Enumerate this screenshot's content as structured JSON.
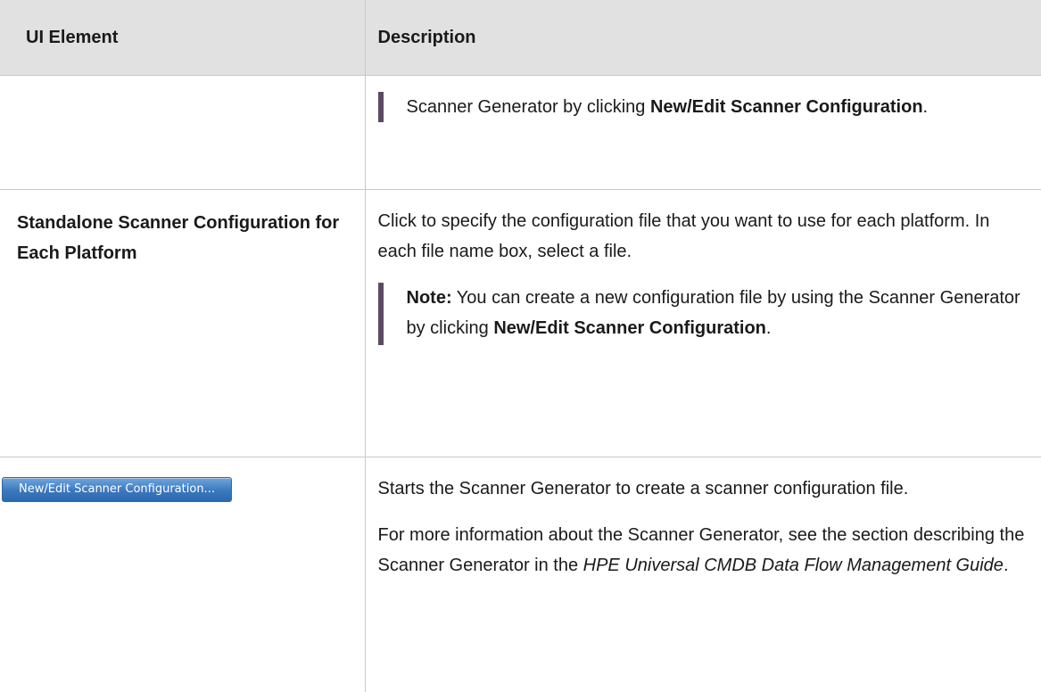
{
  "table": {
    "header": {
      "col1": "UI Element",
      "col2": "Description"
    },
    "row1": {
      "note_text": "Scanner Generator by clicking ",
      "note_bold": "New/Edit Scanner Configuration",
      "note_end": "."
    },
    "row2": {
      "element": "Standalone Scanner Configuration for Each Platform",
      "description": "Click to specify the configuration file that you want to use for each platform. In each file name box, select a file.",
      "note_label": "Note:",
      "note_text": " You can create a new configuration file by using the Scanner Generator by clicking ",
      "note_bold": "New/Edit Scanner Configuration",
      "note_end": "."
    },
    "row3": {
      "button_label": "New/Edit Scanner Configuration...",
      "description": "Starts the Scanner Generator to create a scanner configuration file.",
      "more_prefix": "For more information about the Scanner Generator, see the section describing the Scanner Generator in the ",
      "more_italic": "HPE Universal CMDB Data Flow Management Guide",
      "more_end": "."
    }
  },
  "colors": {
    "header_bg": "#e1e1e1",
    "note_bar": "#5b4a63",
    "button_blue": "#3a78bf"
  }
}
